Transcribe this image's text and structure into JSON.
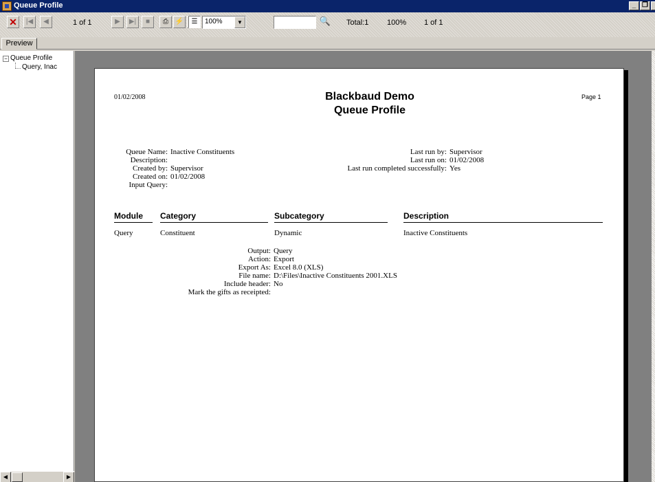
{
  "window": {
    "title": "Queue Profile"
  },
  "toolbar": {
    "page_indicator": "1 of 1",
    "zoom_value": "100%",
    "search_value": "",
    "total_label": "Total:1",
    "percent_label": "100%",
    "page_of_label": "1 of 1"
  },
  "tabs": [
    {
      "label": "Preview"
    }
  ],
  "tree": {
    "root": "Queue Profile",
    "child": "Query, Inac"
  },
  "report": {
    "date": "01/02/2008",
    "org": "Blackbaud Demo",
    "title": "Queue Profile",
    "page": "Page 1",
    "left_fields": [
      {
        "label": "Queue Name:",
        "value": "Inactive Constituents"
      },
      {
        "label": "Description:",
        "value": ""
      },
      {
        "label": "Created by:",
        "value": "Supervisor"
      },
      {
        "label": "Created on:",
        "value": "01/02/2008"
      },
      {
        "label": "Input Query:",
        "value": ""
      }
    ],
    "right_fields": [
      {
        "label": "Last run by:",
        "value": "Supervisor"
      },
      {
        "label": "Last run on:",
        "value": "01/02/2008"
      },
      {
        "label": "Last run completed successfully:",
        "value": "Yes"
      }
    ],
    "columns": [
      "Module",
      "Category",
      "Subcategory",
      "Description"
    ],
    "row": [
      "Query",
      "Constituent",
      "Dynamic",
      "Inactive Constituents"
    ],
    "details": [
      {
        "label": "Output:",
        "value": "Query"
      },
      {
        "label": "Action:",
        "value": "Export"
      },
      {
        "label": "Export As:",
        "value": "Excel 8.0 (XLS)"
      },
      {
        "label": "File name:",
        "value": "D:\\Files\\Inactive Constituents 2001.XLS"
      },
      {
        "label": "Include header:",
        "value": "No"
      },
      {
        "label": "Mark the gifts as receipted:",
        "value": ""
      }
    ]
  }
}
